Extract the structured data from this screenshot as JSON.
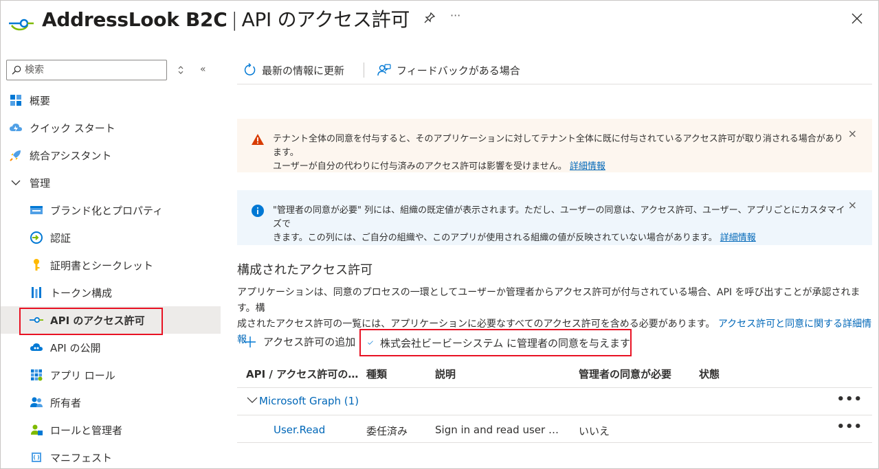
{
  "header": {
    "app_name": "AddressLook B2C",
    "separator": "|",
    "page_name": "API のアクセス許可",
    "more": "···"
  },
  "sidebar": {
    "search_placeholder": "検索",
    "collapse": "«",
    "items": [
      {
        "label": "概要",
        "icon": "overview-grid-icon"
      },
      {
        "label": "クイック スタート",
        "icon": "cloud-quickstart-icon"
      },
      {
        "label": "統合アシスタント",
        "icon": "rocket-icon"
      },
      {
        "label": "管理",
        "icon": "chevron-down-icon"
      },
      {
        "label": "ブランド化とプロパティ",
        "icon": "branding-icon"
      },
      {
        "label": "認証",
        "icon": "authentication-icon"
      },
      {
        "label": "証明書とシークレット",
        "icon": "key-icon"
      },
      {
        "label": "トークン構成",
        "icon": "token-bars-icon"
      },
      {
        "label": "API のアクセス許可",
        "icon": "api-permissions-icon"
      },
      {
        "label": "API の公開",
        "icon": "expose-api-cloud-icon"
      },
      {
        "label": "アプリ ロール",
        "icon": "app-roles-grid-icon"
      },
      {
        "label": "所有者",
        "icon": "owners-people-icon"
      },
      {
        "label": "ロールと管理者",
        "icon": "roles-admins-icon"
      },
      {
        "label": "マニフェスト",
        "icon": "manifest-icon"
      }
    ]
  },
  "toolbar": {
    "refresh_label": "最新の情報に更新",
    "feedback_label": "フィードバックがある場合"
  },
  "warning_banner": {
    "line1": "テナント全体の同意を付与すると、そのアプリケーションに対してテナント全体に既に付与されているアクセス許可が取り消される場合があります。",
    "line2": "ユーザーが自分の代わりに付与済みのアクセス許可は影響を受けません。",
    "link": "詳細情報",
    "close": "×"
  },
  "info_banner": {
    "line1": "\"管理者の同意が必要\" 列には、組織の既定値が表示されます。ただし、ユーザーの同意は、アクセス許可、ユーザー、アプリごとにカスタマイズで",
    "line2": "きます。この列には、ご自分の組織や、このアプリが使用される組織の値が反映されていない場合があります。",
    "link": "詳細情報",
    "close": "×"
  },
  "configured": {
    "title": "構成されたアクセス許可",
    "desc_line1": "アプリケーションは、同意のプロセスの一環としてユーザーか管理者からアクセス許可が付与されている場合、API を呼び出すことが承認されます。構",
    "desc_line2": "成されたアクセス許可の一覧には、アプリケーションに必要なすべてのアクセス許可を含める必要があります。",
    "desc_link": "アクセス許可と同意に関する詳細情報",
    "add_permission": "アクセス許可の追加",
    "grant_consent": "株式会社ビービーシステム に管理者の同意を与えます"
  },
  "table": {
    "columns": [
      "API / アクセス許可の…",
      "種類",
      "説明",
      "管理者の同意が必要",
      "状態"
    ],
    "group": {
      "label": "Microsoft Graph (1)",
      "more": "•••"
    },
    "rows": [
      {
        "name": "User.Read",
        "type": "委任済み",
        "description": "Sign in and read user …",
        "admin_consent": "いいえ",
        "status": "",
        "more": "•••"
      }
    ]
  },
  "colors": {
    "accent": "#0067b8",
    "highlight_border": "#e81123",
    "warning_bg": "#fdf6ef",
    "info_bg": "#eff6fc",
    "active_bg": "#edebe9"
  }
}
